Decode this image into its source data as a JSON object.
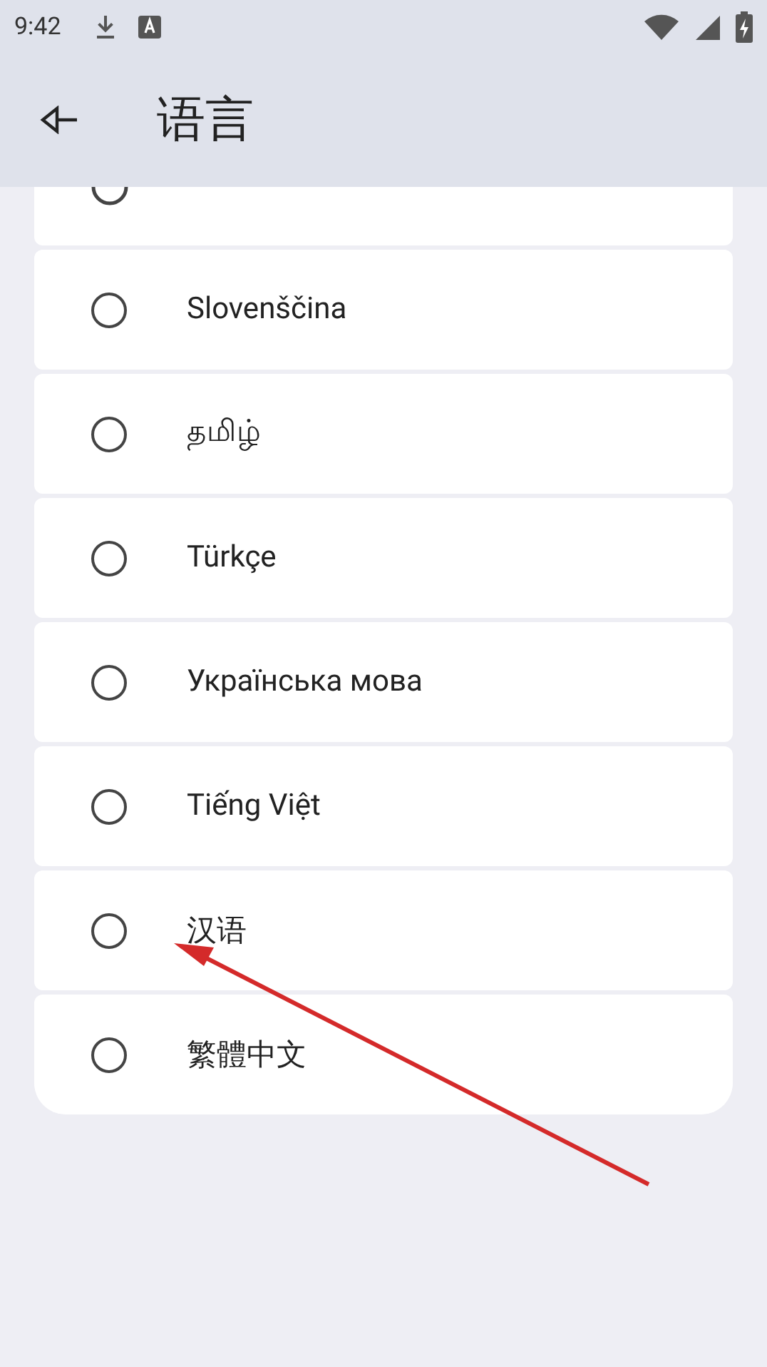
{
  "status_bar": {
    "time": "9:42"
  },
  "app_bar": {
    "title": "语言"
  },
  "languages": [
    {
      "label": "Slovenščina",
      "selected": false
    },
    {
      "label": "தமிழ்",
      "selected": false
    },
    {
      "label": "Türkçe",
      "selected": false
    },
    {
      "label": "Українська мова",
      "selected": false
    },
    {
      "label": "Tiếng Việt",
      "selected": false
    },
    {
      "label": "汉语",
      "selected": false
    },
    {
      "label": "繁體中文",
      "selected": false
    }
  ],
  "annotation": {
    "kind": "arrow"
  }
}
